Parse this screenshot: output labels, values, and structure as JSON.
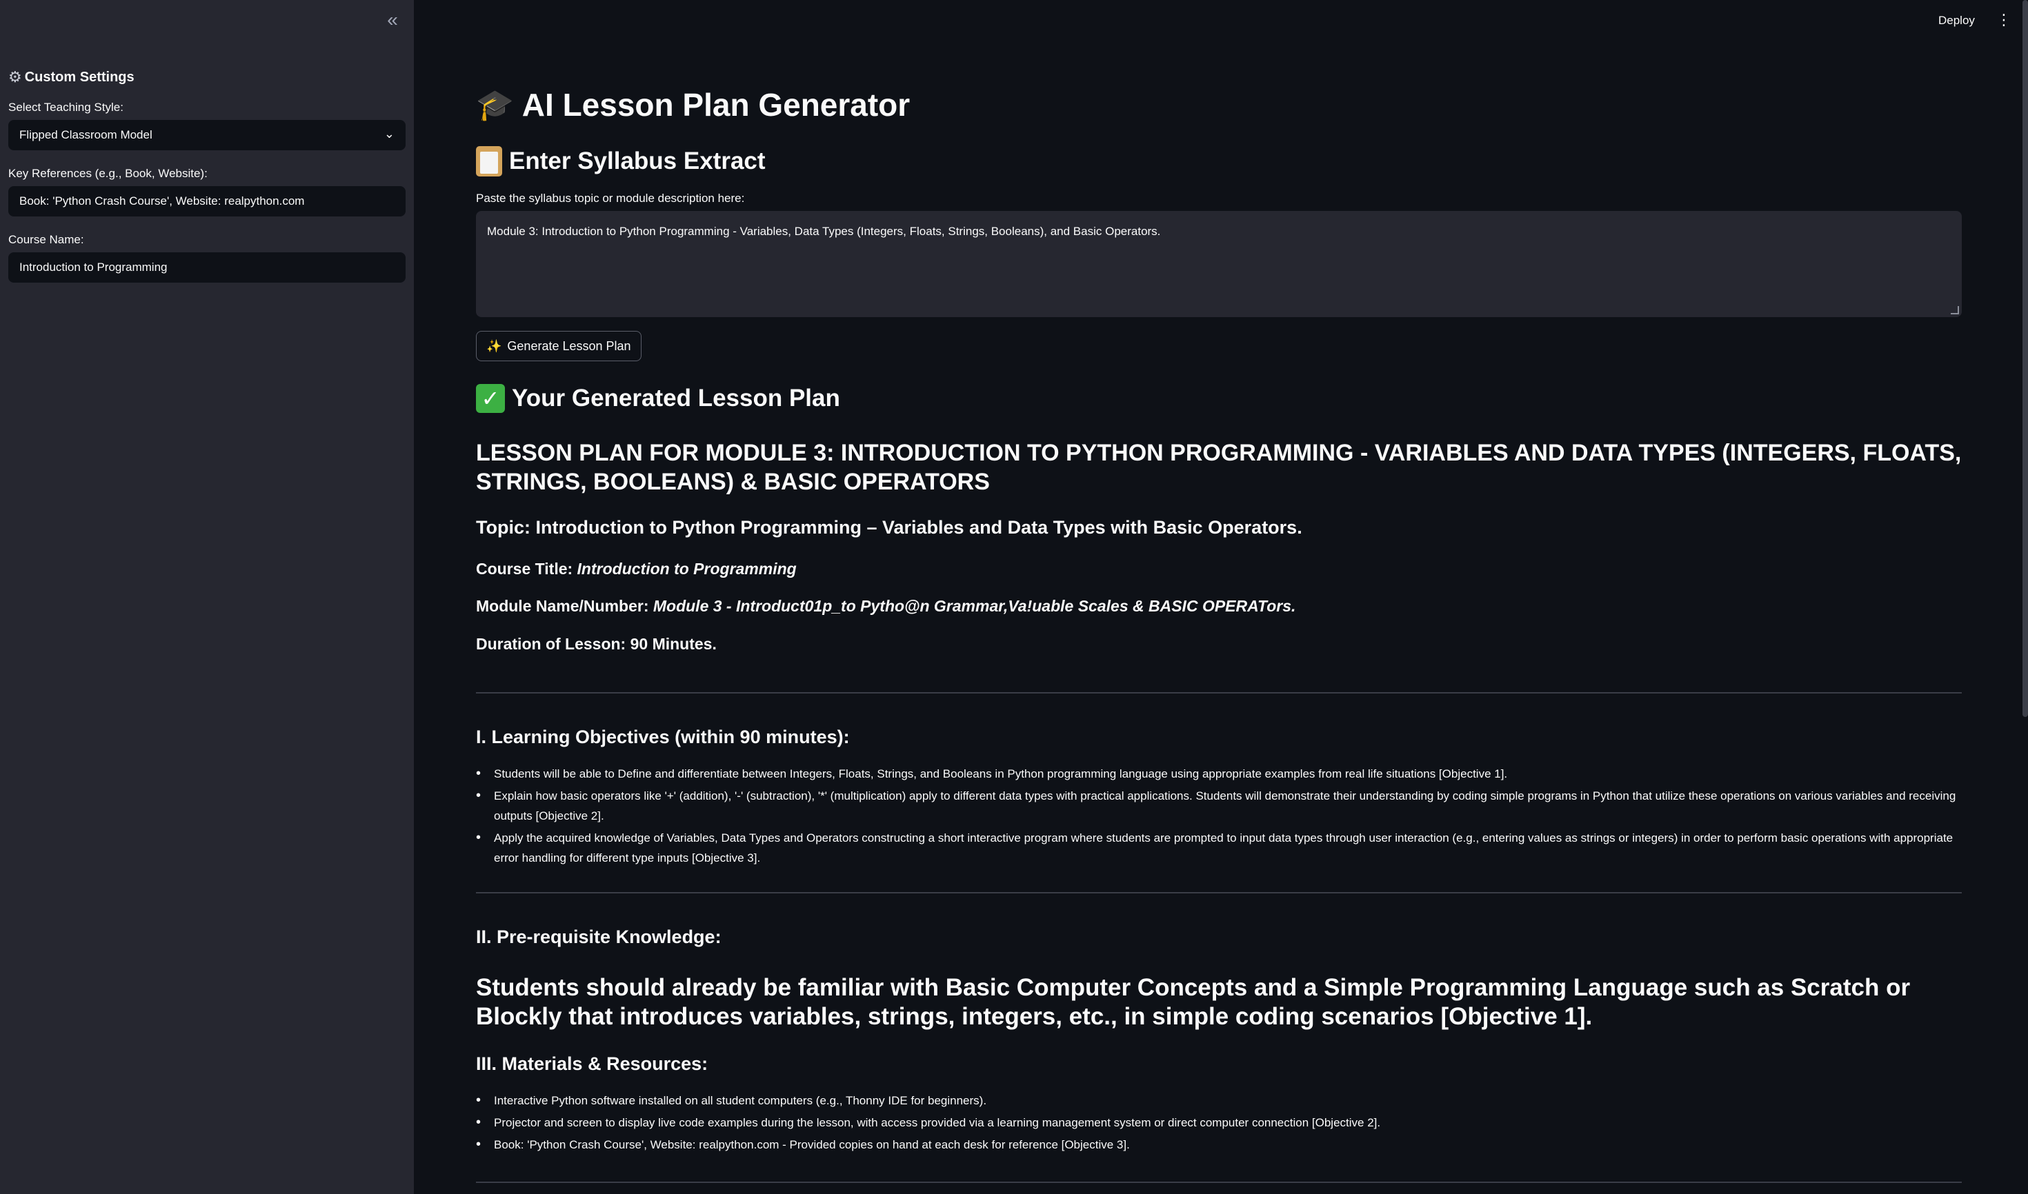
{
  "sidebar": {
    "collapse_icon": "«",
    "title": "Custom Settings",
    "teaching_style_label": "Select Teaching Style:",
    "teaching_style_value": "Flipped Classroom Model",
    "references_label": "Key References (e.g., Book, Website):",
    "references_value": "Book: 'Python Crash Course', Website: realpython.com",
    "course_name_label": "Course Name:",
    "course_name_value": "Introduction to Programming"
  },
  "topbar": {
    "deploy_label": "Deploy",
    "menu_icon": "⋮"
  },
  "main": {
    "app_title": "AI Lesson Plan Generator",
    "syllabus_heading": "Enter Syllabus Extract",
    "syllabus_label": "Paste the syllabus topic or module description here:",
    "syllabus_value": "Module 3: Introduction to Python Programming - Variables, Data Types (Integers, Floats, Strings, Booleans), and Basic Operators.",
    "generate_button": "Generate Lesson Plan",
    "generated_heading": "Your Generated Lesson Plan"
  },
  "lesson_plan": {
    "title": "LESSON PLAN FOR MODULE 3: INTRODUCTION TO PYTHON PROGRAMMING - VARIABLES AND DATA TYPES (INTEGERS, FLOATS, STRINGS, BOOLEANS) & BASIC OPERATORS",
    "topic": "Topic: Introduction to Python Programming – Variables and Data Types with Basic Operators.",
    "course_title_label": "Course Title:",
    "course_title_value": "Introduction to Programming",
    "module_label": "Module Name/Number:",
    "module_value": "Module 3 - Introduct01p_to Pytho@n Grammar,Va!uable Scales & BASIC OPERATors.",
    "duration": "Duration of Lesson: 90 Minutes.",
    "objectives_heading": "I. Learning Objectives (within 90 minutes):",
    "objectives": [
      "Students will be able to Define and differentiate between Integers, Floats, Strings, and Booleans in Python programming language using appropriate examples from real life situations [Objective 1].",
      "Explain how basic operators like '+' (addition), '-' (subtraction), '*' (multiplication) apply to different data types with practical applications. Students will demonstrate their understanding by coding simple programs in Python that utilize these operations on various variables and receiving outputs [Objective 2].",
      "Apply the acquired knowledge of Variables, Data Types and Operators constructing a short interactive program where students are prompted to input data types through user interaction (e.g., entering values as strings or integers) in order to perform basic operations with appropriate error handling for different type inputs [Objective 3]."
    ],
    "prereq_heading": "II. Pre-requisite Knowledge:",
    "prereq_text": "Students should already be familiar with Basic Computer Concepts and a Simple Programming Language such as Scratch or Blockly that introduces variables, strings, integers, etc., in simple coding scenarios [Objective 1].",
    "materials_heading": "III. Materials & Resources:",
    "materials": [
      "Interactive Python software installed on all student computers (e.g., Thonny IDE for beginners).",
      "Projector and screen to display live code examples during the lesson, with access provided via a learning management system or direct computer connection [Objective 2].",
      "Book: 'Python Crash Course', Website: realpython.com - Provided copies on hand at each desk for reference [Objective 3]."
    ]
  },
  "icons": {
    "gear": "gear-icon",
    "cap": "graduation-cap-icon",
    "clipboard": "clipboard-icon",
    "sparkles": "sparkles-icon",
    "check": "check-mark-icon",
    "chevron": "chevron-down-icon"
  }
}
